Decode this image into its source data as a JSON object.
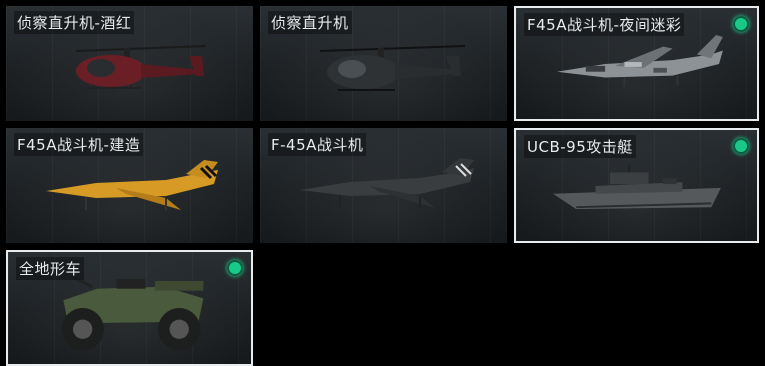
{
  "cards": [
    {
      "label": "侦察直升机-酒红",
      "selected": false,
      "equipped": false,
      "icon": "helicopter-icon",
      "color": "#6a1f26"
    },
    {
      "label": "侦察直升机",
      "selected": false,
      "equipped": false,
      "icon": "helicopter-icon",
      "color": "#2f3235"
    },
    {
      "label": "F45A战斗机-夜间迷彩",
      "selected": true,
      "equipped": true,
      "icon": "jet-icon",
      "color": "#8d9296"
    },
    {
      "label": "F45A战斗机-建造",
      "selected": false,
      "equipped": false,
      "icon": "jet-icon",
      "color": "#d79a25"
    },
    {
      "label": "F-45A战斗机",
      "selected": false,
      "equipped": false,
      "icon": "jet-icon",
      "color": "#3a3d40"
    },
    {
      "label": "UCB-95攻击艇",
      "selected": true,
      "equipped": true,
      "icon": "boat-icon",
      "color": "#55595c"
    },
    {
      "label": "全地形车",
      "selected": true,
      "equipped": true,
      "icon": "atv-icon",
      "color": "#4a5a3c"
    }
  ],
  "colors": {
    "selected_border": "#e9ecee",
    "equipped_dot": "#19c98a",
    "background": "#000000"
  }
}
